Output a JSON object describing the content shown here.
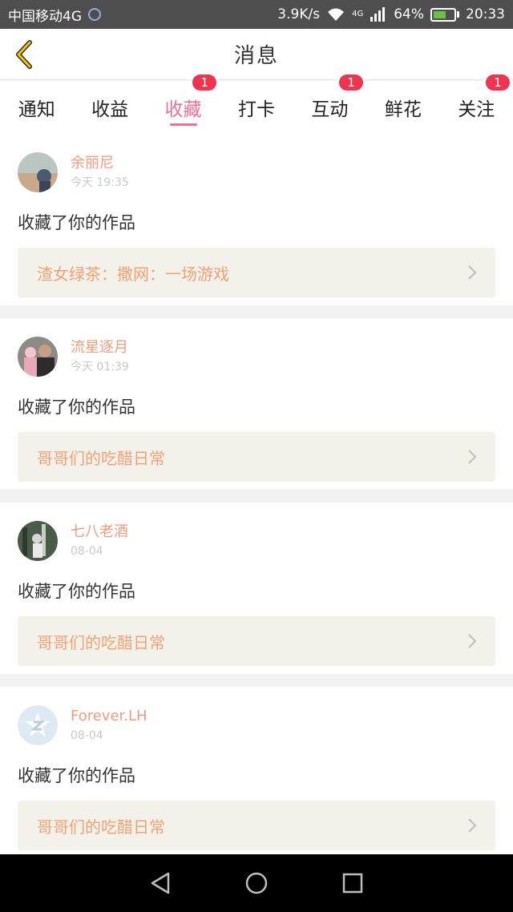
{
  "status_bar": {
    "carrier": "中国移动4G",
    "speed": "3.9K/s",
    "network": "4G",
    "battery": "64%",
    "time": "20:33"
  },
  "header": {
    "title": "消息"
  },
  "tabs": [
    {
      "label": "通知",
      "badge": ""
    },
    {
      "label": "收益",
      "badge": ""
    },
    {
      "label": "收藏",
      "badge": "1",
      "active": true
    },
    {
      "label": "打卡",
      "badge": ""
    },
    {
      "label": "互动",
      "badge": "1"
    },
    {
      "label": "鲜花",
      "badge": ""
    },
    {
      "label": "关注",
      "badge": "1"
    }
  ],
  "items": [
    {
      "user": "余丽尼",
      "time": "今天 19:35",
      "action": "收藏了你的作品",
      "work": "渣女绿茶：撒网：一场游戏"
    },
    {
      "user": "流星逐月",
      "time": "今天 01:39",
      "action": "收藏了你的作品",
      "work": "哥哥们的吃醋日常"
    },
    {
      "user": "七八老酒",
      "time": "08-04",
      "action": "收藏了你的作品",
      "work": "哥哥们的吃醋日常"
    },
    {
      "user": "Forever.LH",
      "time": "08-04",
      "action": "收藏了你的作品",
      "work": "哥哥们的吃醋日常"
    }
  ],
  "colors": {
    "accent": "#f06f97",
    "badge": "#f0344f",
    "username": "#f19b7a",
    "card_bg": "#f3f2ea",
    "card_text": "#f1a176"
  }
}
